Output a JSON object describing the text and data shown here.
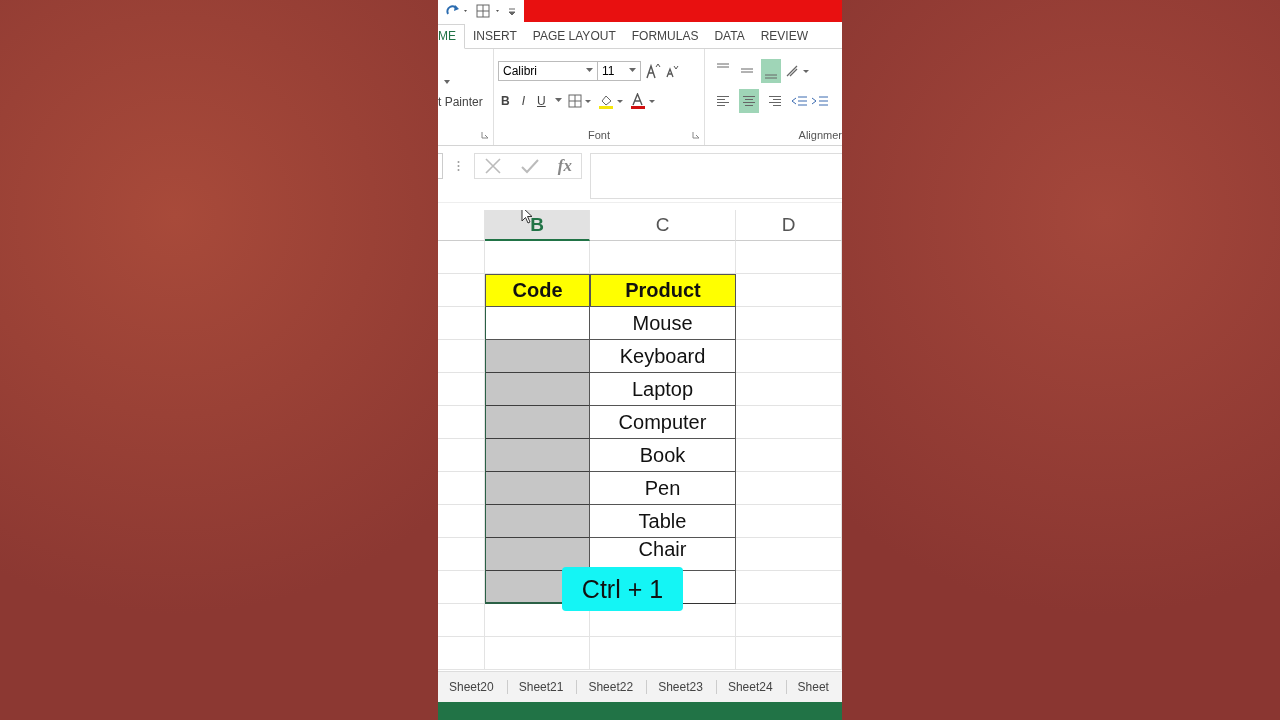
{
  "tabs": [
    {
      "label": "ME",
      "selected": true
    },
    {
      "label": "INSERT",
      "selected": false
    },
    {
      "label": "PAGE LAYOUT",
      "selected": false
    },
    {
      "label": "FORMULAS",
      "selected": false
    },
    {
      "label": "DATA",
      "selected": false
    },
    {
      "label": "REVIEW",
      "selected": false
    }
  ],
  "ribbon": {
    "clipboard_label": "t Painter",
    "font_name": "Calibri",
    "font_size": "11",
    "format_buttons": [
      "B",
      "I",
      "U"
    ],
    "font_group_label": "Font",
    "alignment_group_label": "Alignmer",
    "vertical_align": [
      {
        "selected": false
      },
      {
        "selected": false
      },
      {
        "selected": true
      }
    ],
    "horizontal_align": [
      {
        "selected": false
      },
      {
        "selected": true
      },
      {
        "selected": false
      }
    ]
  },
  "formula_bar": {
    "fx": "fx"
  },
  "columns": [
    {
      "label": "B",
      "selected": true
    },
    {
      "label": "C",
      "selected": false
    },
    {
      "label": "D",
      "selected": false
    }
  ],
  "table": {
    "headers": [
      "Code",
      "Product"
    ],
    "rows": [
      {
        "product": "Mouse",
        "code_selected": false
      },
      {
        "product": "Keyboard",
        "code_selected": true
      },
      {
        "product": "Laptop",
        "code_selected": true
      },
      {
        "product": "Computer",
        "code_selected": true
      },
      {
        "product": "Book",
        "code_selected": true
      },
      {
        "product": "Pen",
        "code_selected": true
      },
      {
        "product": "Table",
        "code_selected": true
      },
      {
        "product": "Chair",
        "code_selected": true
      },
      {
        "code_selected": true
      }
    ]
  },
  "sheet_tabs": [
    "Sheet20",
    "Sheet21",
    "Sheet22",
    "Sheet23",
    "Sheet24",
    "Sheet"
  ],
  "overlay": {
    "text": "Ctrl + 1"
  }
}
